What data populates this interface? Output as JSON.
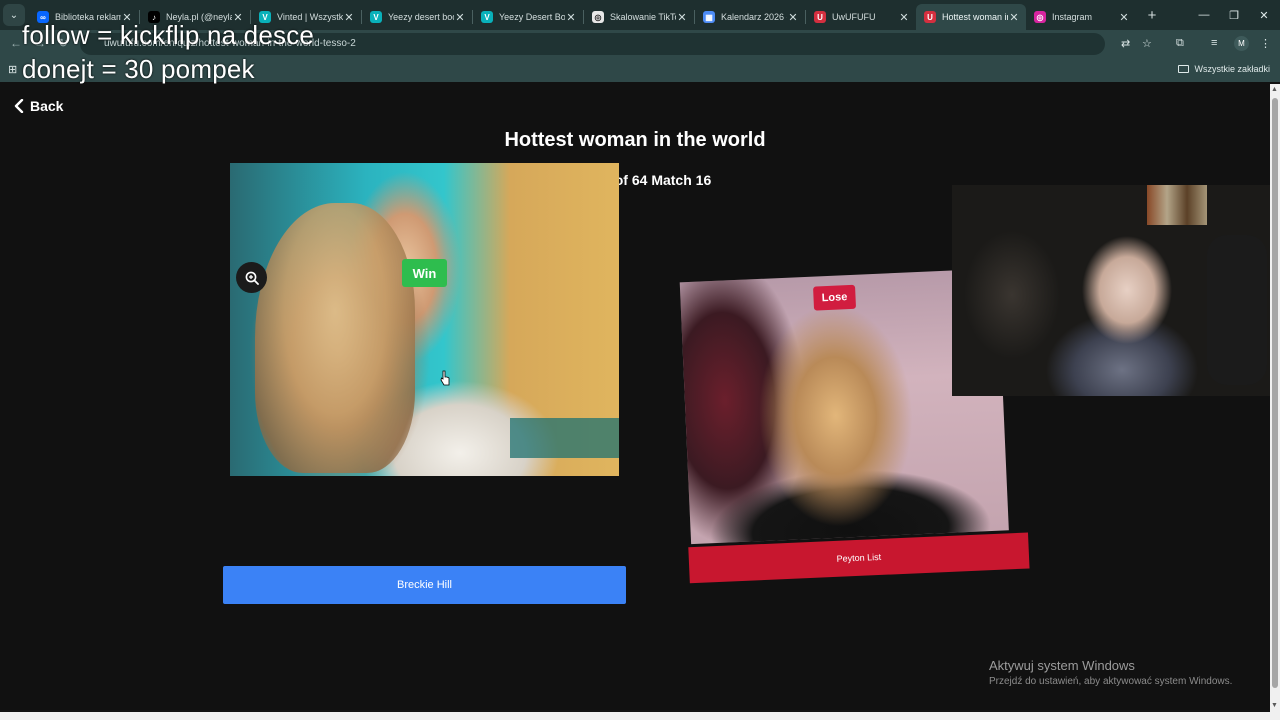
{
  "browser": {
    "tabs": [
      {
        "label": "Biblioteka reklam",
        "favicon": "meta-icon",
        "color": "#0866ff",
        "glyph": "∞"
      },
      {
        "label": "Neyla.pl (@neyla.p",
        "favicon": "tiktok-icon",
        "color": "#000000",
        "glyph": "♪"
      },
      {
        "label": "Vinted | Wszystkie",
        "favicon": "vinted-icon",
        "color": "#09b1ba",
        "glyph": "V"
      },
      {
        "label": "Yeezy desert boot",
        "favicon": "vinted-icon",
        "color": "#09b1ba",
        "glyph": "V"
      },
      {
        "label": "Yeezy Desert Boot",
        "favicon": "vinted-icon",
        "color": "#09b1ba",
        "glyph": "V"
      },
      {
        "label": "Skalowanie TikTok",
        "favicon": "openai-icon",
        "color": "#e8e8e8",
        "glyph": "◎"
      },
      {
        "label": "Kalendarz 2026 -",
        "favicon": "calendar-icon",
        "color": "#4c8bf5",
        "glyph": "▦"
      },
      {
        "label": "UwUFUFU",
        "favicon": "uwufufu-icon",
        "color": "#d32f3f",
        "glyph": "U"
      },
      {
        "label": "Hottest woman in",
        "favicon": "uwufufu-icon",
        "color": "#d32f3f",
        "glyph": "U",
        "active": true
      },
      {
        "label": "Instagram",
        "favicon": "instagram-icon",
        "color": "#d6249f",
        "glyph": "◎"
      }
    ],
    "new_tab": "+",
    "url": "uwufufu.com/en/quiz/hottest-woman-in-the-world-tesso-2",
    "profile_initial": "M",
    "bookmarks_all": "Wszystkie zakładki"
  },
  "overlay": {
    "line1": "follow = kickflip na desce",
    "line2": "donejt = 30 pompek"
  },
  "page": {
    "back_label": "Back",
    "title": "Hottest woman in the world",
    "subtitle": "Rounds of 64 Match 16"
  },
  "left_choice": {
    "name": "Breckie Hill",
    "badge": "Win",
    "badge_color": "#2ebd4e",
    "button_color": "#3b82f6"
  },
  "right_choice": {
    "name": "Peyton List",
    "badge": "Lose",
    "badge_color": "#d11d3f",
    "button_color": "#c8172f"
  },
  "windows_watermark": {
    "line1": "Aktywuj system Windows",
    "line2": "Przejdź do ustawień, aby aktywować system Windows."
  }
}
